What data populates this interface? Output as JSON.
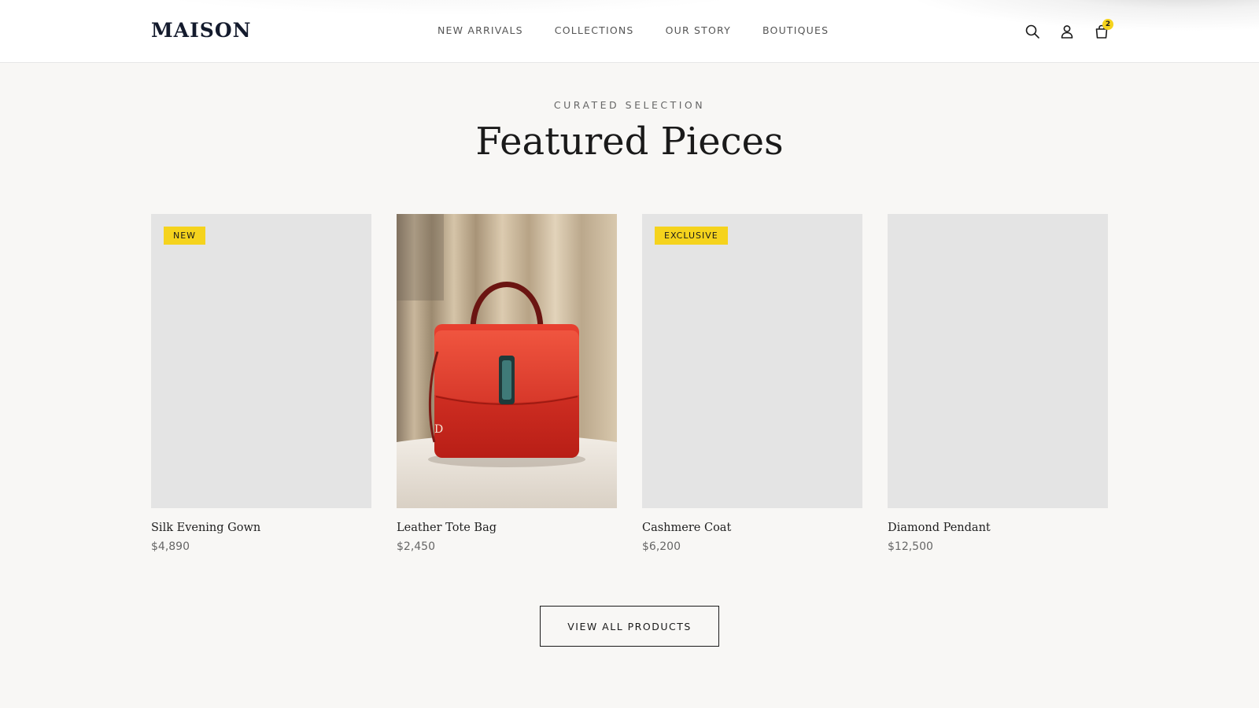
{
  "header": {
    "logo": "MAISON",
    "nav": [
      "NEW ARRIVALS",
      "COLLECTIONS",
      "OUR STORY",
      "BOUTIQUES"
    ],
    "icons": [
      "search-icon",
      "account-icon",
      "shopping-bag-icon"
    ],
    "cart_count": "2"
  },
  "section": {
    "eyebrow": "CURATED SELECTION",
    "title": "Featured Pieces"
  },
  "products": [
    {
      "name": "Silk Evening Gown",
      "price": "$4,890",
      "badge": "NEW",
      "image": "placeholder"
    },
    {
      "name": "Leather Tote Bag",
      "price": "$2,450",
      "badge": "",
      "image": "red-leather-handbag-photo"
    },
    {
      "name": "Cashmere Coat",
      "price": "$6,200",
      "badge": "EXCLUSIVE",
      "image": "placeholder"
    },
    {
      "name": "Diamond Pendant",
      "price": "$12,500",
      "badge": "",
      "image": "placeholder"
    }
  ],
  "cta": {
    "label": "VIEW ALL PRODUCTS"
  },
  "colors": {
    "background": "#f8f7f5",
    "badge": "#f5d31d",
    "placeholder": "#e4e4e4",
    "logo": "#141b2d"
  }
}
